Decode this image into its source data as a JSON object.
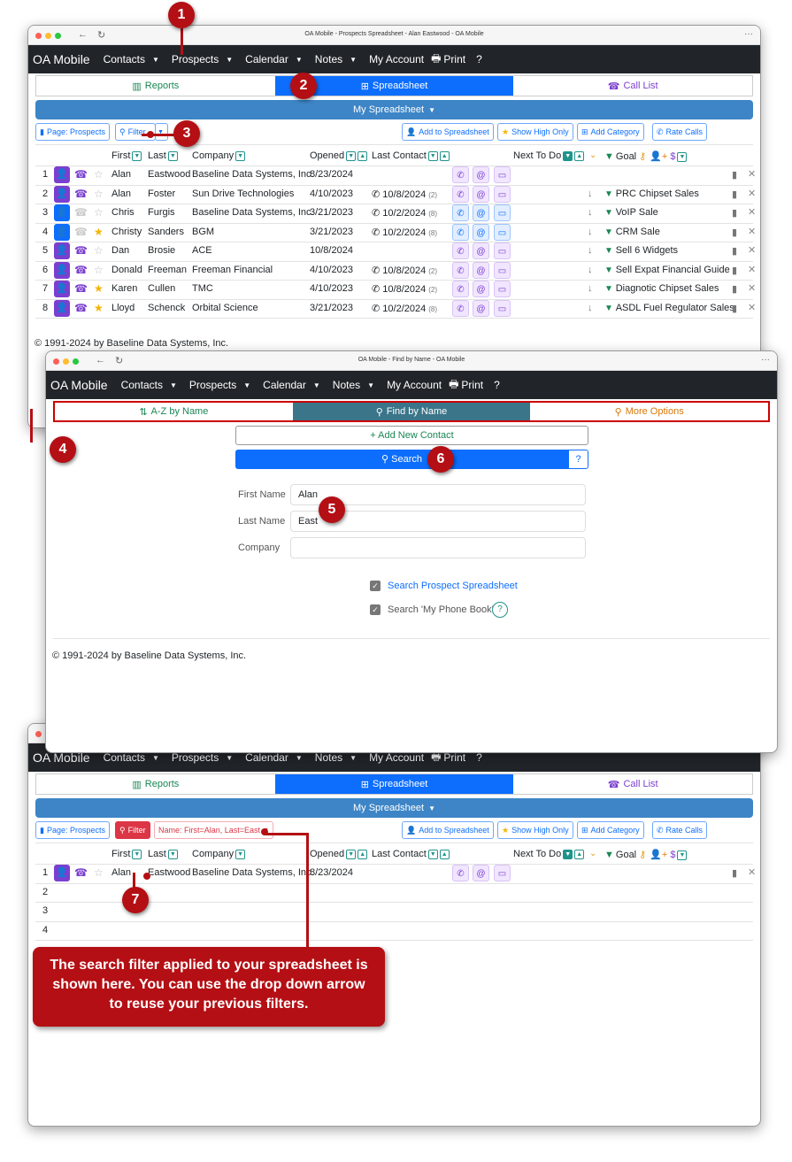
{
  "window_title_spreadsheet": "OA Mobile - Prospects Spreadsheet - Alan Eastwood - OA Mobile",
  "window_title_find": "OA Mobile - Find by Name - OA Mobile",
  "nav": {
    "brand": "OA Mobile",
    "items": [
      "Contacts",
      "Prospects",
      "Calendar",
      "Notes"
    ],
    "my_account": "My Account",
    "print": "Print",
    "help": "?"
  },
  "tabs": {
    "reports": "Reports",
    "spreadsheet": "Spreadsheet",
    "call_list": "Call List"
  },
  "my_spreadsheet": "My Spreadsheet",
  "toolbar": {
    "page": "Page: Prospects",
    "filter": "Filter",
    "add": "Add to Spreadsheet",
    "high": "Show High Only",
    "category": "Add Category",
    "rate": "Rate Calls"
  },
  "filter_value": "Name: First=Alan, Last=East",
  "columns": {
    "first": "First",
    "last": "Last",
    "company": "Company",
    "opened": "Opened",
    "last_contact": "Last Contact",
    "next": "Next To Do",
    "goal": "Goal"
  },
  "rows": [
    {
      "n": "1",
      "first": "Alan",
      "last": "Eastwood",
      "company": "Baseline Data Systems, Inc.",
      "opened": "8/23/2024",
      "lc": "",
      "lcn": "",
      "goal": "",
      "blue": false,
      "phone": true,
      "star": false
    },
    {
      "n": "2",
      "first": "Alan",
      "last": "Foster",
      "company": "Sun Drive Technologies",
      "opened": "4/10/2023",
      "lc": "10/8/2024",
      "lcn": "(2)",
      "goal": "PRC Chipset Sales",
      "blue": false,
      "phone": true,
      "star": false
    },
    {
      "n": "3",
      "first": "Chris",
      "last": "Furgis",
      "company": "Baseline Data Systems, Inc.",
      "opened": "3/21/2023",
      "lc": "10/2/2024",
      "lcn": "(8)",
      "goal": "VoIP Sale",
      "blue": true,
      "phone": false,
      "star": false
    },
    {
      "n": "4",
      "first": "Christy",
      "last": "Sanders",
      "company": "BGM",
      "opened": "3/21/2023",
      "lc": "10/2/2024",
      "lcn": "(8)",
      "goal": "CRM Sale",
      "blue": true,
      "phone": false,
      "star": true
    },
    {
      "n": "5",
      "first": "Dan",
      "last": "Brosie",
      "company": "ACE",
      "opened": "10/8/2024",
      "lc": "",
      "lcn": "",
      "goal": "Sell 6 Widgets",
      "blue": false,
      "phone": true,
      "star": false
    },
    {
      "n": "6",
      "first": "Donald",
      "last": "Freeman",
      "company": "Freeman Financial",
      "opened": "4/10/2023",
      "lc": "10/8/2024",
      "lcn": "(2)",
      "goal": "Sell Expat Financial Guide",
      "blue": false,
      "phone": true,
      "star": false
    },
    {
      "n": "7",
      "first": "Karen",
      "last": "Cullen",
      "company": "TMC",
      "opened": "4/10/2023",
      "lc": "10/8/2024",
      "lcn": "(2)",
      "goal": "Diagnotic Chipset Sales",
      "blue": false,
      "phone": true,
      "star": true
    },
    {
      "n": "8",
      "first": "Lloyd",
      "last": "Schenck",
      "company": "Orbital Science",
      "opened": "3/21/2023",
      "lc": "10/2/2024",
      "lcn": "(8)",
      "goal": "ASDL Fuel Regulator Sales",
      "blue": false,
      "phone": true,
      "star": true
    }
  ],
  "filtered_rows": [
    "1",
    "2",
    "3",
    "4"
  ],
  "footer": "© 1991-2024 by Baseline Data Systems, Inc.",
  "find": {
    "tabs": {
      "az": "A-Z by Name",
      "find": "Find by Name",
      "more": "More Options"
    },
    "add_new": "+ Add New Contact",
    "search": "Search",
    "help": "?",
    "fields": [
      {
        "label": "First Name",
        "value": "Alan"
      },
      {
        "label": "Last Name",
        "value": "East"
      },
      {
        "label": "Company",
        "value": ""
      }
    ],
    "check1": "Search Prospect Spreadsheet",
    "check2": "Search 'My Phone Book'",
    "check2_help": "?"
  },
  "callouts": [
    "1",
    "2",
    "3",
    "4",
    "5",
    "6",
    "7"
  ],
  "callout_text": "The search filter applied to your spreadsheet is shown here.  You can use the drop down arrow to reuse your previous filters.",
  "colors": {
    "nav": "#212529",
    "active_tab": "#0d6efd",
    "my_bar": "#3d85c6",
    "purple": "#7b3fd0",
    "callout": "#b40f14",
    "teal": "#20948b"
  }
}
